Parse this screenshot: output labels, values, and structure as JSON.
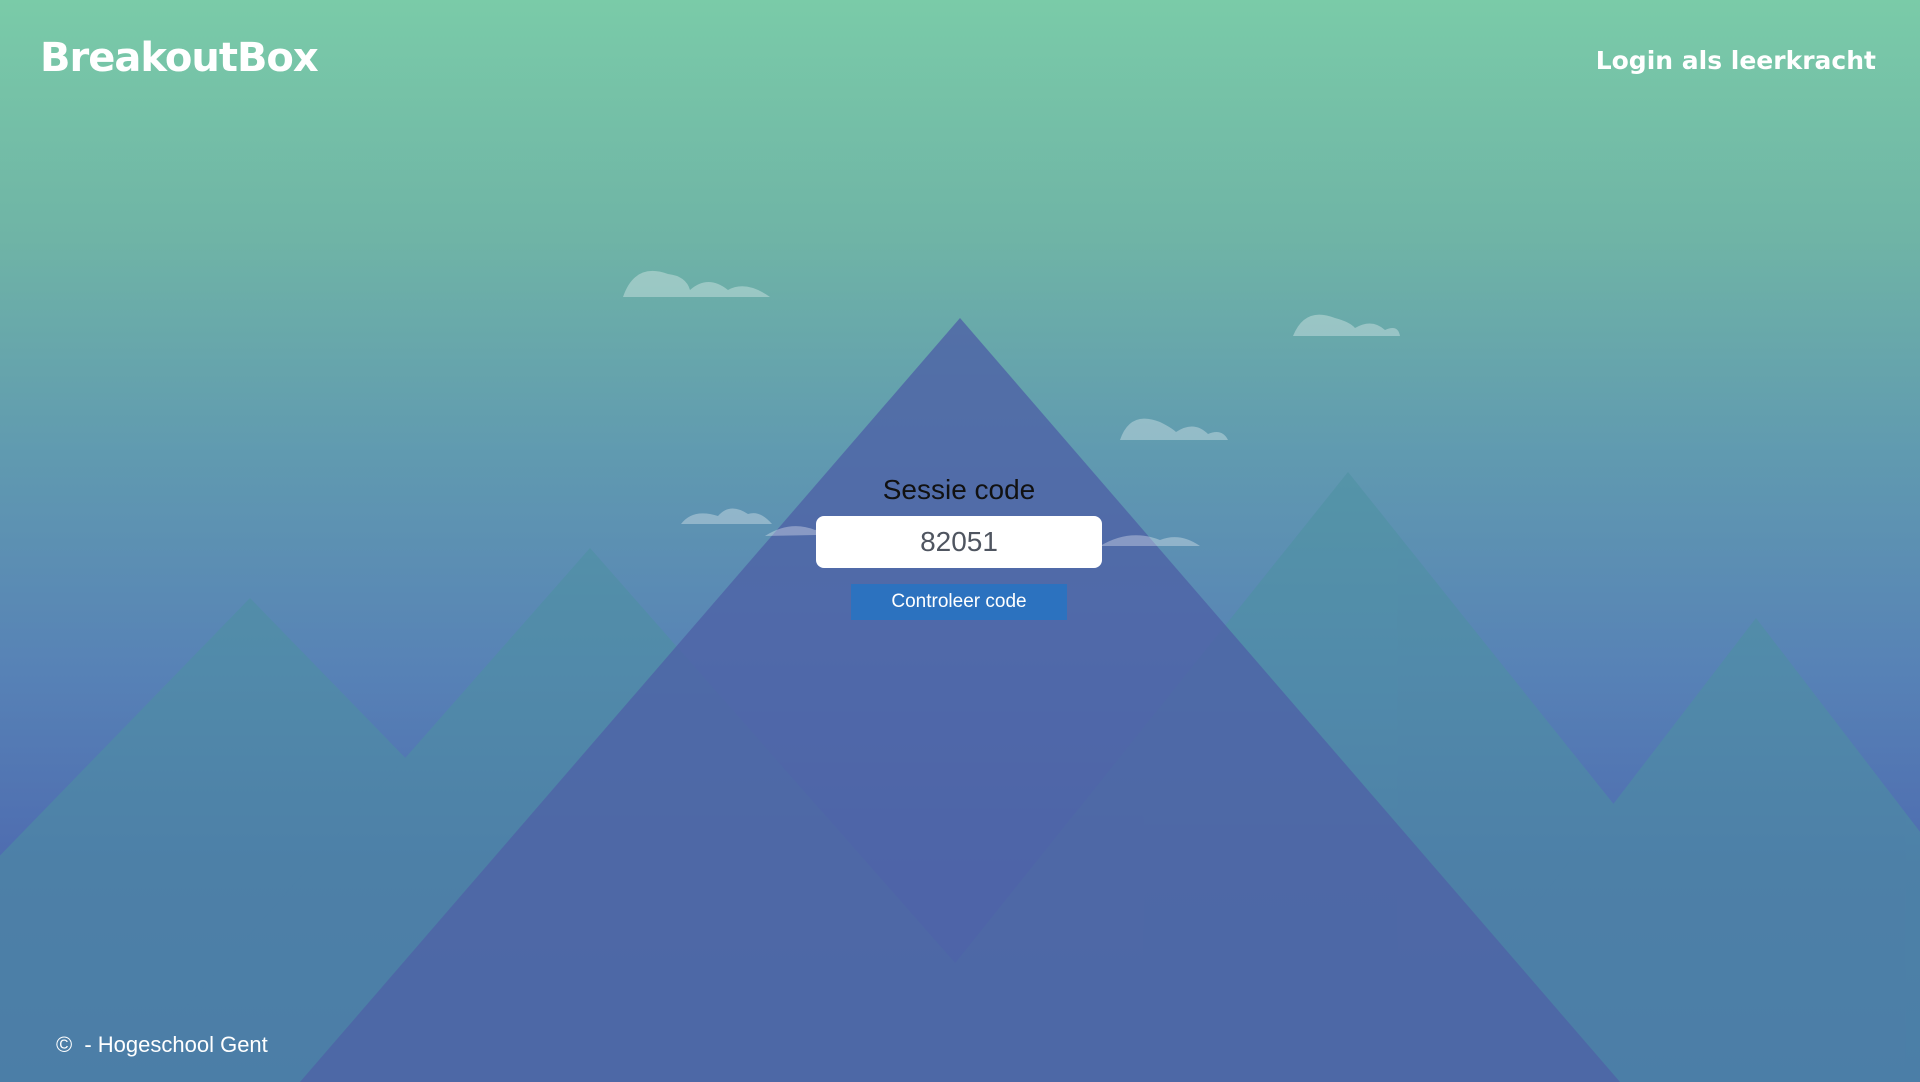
{
  "header": {
    "logo_text": "BreakoutBox",
    "login_link": "Login als leerkracht"
  },
  "session": {
    "title": "Sessie code",
    "code_value": "82051",
    "submit_label": "Controleer code"
  },
  "footer": {
    "copyright_symbol": "©",
    "text": "- Hogeschool Gent"
  },
  "colors": {
    "sky_top": "#7acba8",
    "sky_bottom": "#4a67b0",
    "button": "#2c72bf",
    "central_mountain": "#4e63a6",
    "side_mountains": "#4d91a1"
  }
}
